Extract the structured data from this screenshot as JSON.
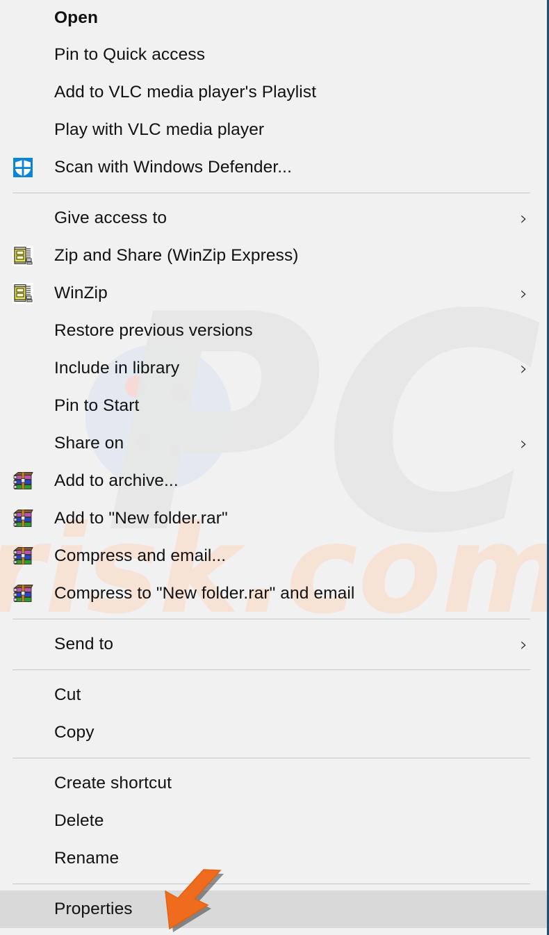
{
  "context_menu": {
    "background_color": "#f1f1f1",
    "selected_background_color": "#d9d9d9",
    "border_color": "#1d4f77",
    "separator_color": "#c7c7c7",
    "groups": [
      {
        "items": [
          {
            "label": "Open",
            "icon": "none",
            "bold": true,
            "submenu": false,
            "selected": false
          },
          {
            "label": "Pin to Quick access",
            "icon": "none",
            "bold": false,
            "submenu": false,
            "selected": false
          },
          {
            "label": "Add to VLC media player's Playlist",
            "icon": "none",
            "bold": false,
            "submenu": false,
            "selected": false
          },
          {
            "label": "Play with VLC media player",
            "icon": "none",
            "bold": false,
            "submenu": false,
            "selected": false
          },
          {
            "label": "Scan with Windows Defender...",
            "icon": "windows-defender-shield-icon",
            "bold": false,
            "submenu": false,
            "selected": false
          }
        ]
      },
      {
        "items": [
          {
            "label": "Give access to",
            "icon": "none",
            "bold": false,
            "submenu": true,
            "selected": false
          },
          {
            "label": "Zip and Share (WinZip Express)",
            "icon": "winzip-icon",
            "bold": false,
            "submenu": false,
            "selected": false
          },
          {
            "label": "WinZip",
            "icon": "winzip-icon",
            "bold": false,
            "submenu": true,
            "selected": false
          },
          {
            "label": "Restore previous versions",
            "icon": "none",
            "bold": false,
            "submenu": false,
            "selected": false
          },
          {
            "label": "Include in library",
            "icon": "none",
            "bold": false,
            "submenu": true,
            "selected": false
          },
          {
            "label": "Pin to Start",
            "icon": "none",
            "bold": false,
            "submenu": false,
            "selected": false
          },
          {
            "label": "Share on",
            "icon": "none",
            "bold": false,
            "submenu": true,
            "selected": false
          },
          {
            "label": "Add to archive...",
            "icon": "winrar-icon",
            "bold": false,
            "submenu": false,
            "selected": false
          },
          {
            "label": "Add to \"New folder.rar\"",
            "icon": "winrar-icon",
            "bold": false,
            "submenu": false,
            "selected": false
          },
          {
            "label": "Compress and email...",
            "icon": "winrar-icon",
            "bold": false,
            "submenu": false,
            "selected": false
          },
          {
            "label": "Compress to \"New folder.rar\" and email",
            "icon": "winrar-icon",
            "bold": false,
            "submenu": false,
            "selected": false
          }
        ]
      },
      {
        "items": [
          {
            "label": "Send to",
            "icon": "none",
            "bold": false,
            "submenu": true,
            "selected": false
          }
        ]
      },
      {
        "items": [
          {
            "label": "Cut",
            "icon": "none",
            "bold": false,
            "submenu": false,
            "selected": false
          },
          {
            "label": "Copy",
            "icon": "none",
            "bold": false,
            "submenu": false,
            "selected": false
          }
        ]
      },
      {
        "items": [
          {
            "label": "Create shortcut",
            "icon": "none",
            "bold": false,
            "submenu": false,
            "selected": false
          },
          {
            "label": "Delete",
            "icon": "none",
            "bold": false,
            "submenu": false,
            "selected": false
          },
          {
            "label": "Rename",
            "icon": "none",
            "bold": false,
            "submenu": false,
            "selected": false
          }
        ]
      },
      {
        "items": [
          {
            "label": "Properties",
            "icon": "none",
            "bold": false,
            "submenu": false,
            "selected": true
          }
        ]
      }
    ],
    "submenu_glyph": "›"
  },
  "annotation": {
    "arrow_color": "#ef6c1f",
    "arrow_shadow_color": "#3a3a3a",
    "points_at": "Properties"
  },
  "watermark": {
    "primary_text": "PC",
    "secondary_text": "risk.com",
    "primary_color": "#e6e6e6",
    "secondary_color": "#f7ded0",
    "circle_color": "#dde4ee"
  }
}
